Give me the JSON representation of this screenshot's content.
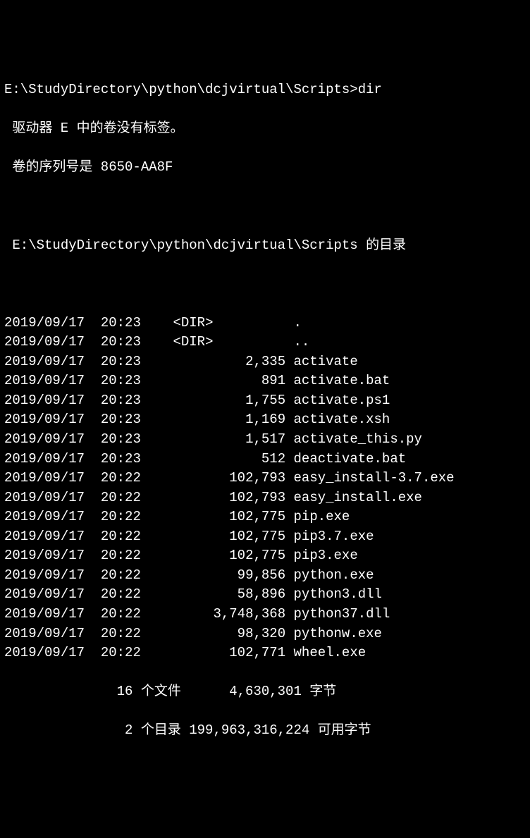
{
  "prompt": {
    "path": "E:\\StudyDirectory\\python\\dcjvirtual\\Scripts>",
    "command": "dir"
  },
  "header": {
    "volume_line": " 驱动器 E 中的卷没有标签。",
    "serial_line": " 卷的序列号是 8650-AA8F",
    "dir_path_line": " E:\\StudyDirectory\\python\\dcjvirtual\\Scripts 的目录"
  },
  "rows": [
    {
      "date": "2019/09/17",
      "time": "20:23",
      "size": "<DIR>         ",
      "name": "."
    },
    {
      "date": "2019/09/17",
      "time": "20:23",
      "size": "<DIR>         ",
      "name": ".."
    },
    {
      "date": "2019/09/17",
      "time": "20:23",
      "size": "         2,335",
      "name": "activate"
    },
    {
      "date": "2019/09/17",
      "time": "20:23",
      "size": "           891",
      "name": "activate.bat"
    },
    {
      "date": "2019/09/17",
      "time": "20:23",
      "size": "         1,755",
      "name": "activate.ps1"
    },
    {
      "date": "2019/09/17",
      "time": "20:23",
      "size": "         1,169",
      "name": "activate.xsh"
    },
    {
      "date": "2019/09/17",
      "time": "20:23",
      "size": "         1,517",
      "name": "activate_this.py"
    },
    {
      "date": "2019/09/17",
      "time": "20:23",
      "size": "           512",
      "name": "deactivate.bat"
    },
    {
      "date": "2019/09/17",
      "time": "20:22",
      "size": "       102,793",
      "name": "easy_install-3.7.exe"
    },
    {
      "date": "2019/09/17",
      "time": "20:22",
      "size": "       102,793",
      "name": "easy_install.exe"
    },
    {
      "date": "2019/09/17",
      "time": "20:22",
      "size": "       102,775",
      "name": "pip.exe"
    },
    {
      "date": "2019/09/17",
      "time": "20:22",
      "size": "       102,775",
      "name": "pip3.7.exe"
    },
    {
      "date": "2019/09/17",
      "time": "20:22",
      "size": "       102,775",
      "name": "pip3.exe"
    },
    {
      "date": "2019/09/17",
      "time": "20:22",
      "size": "        99,856",
      "name": "python.exe"
    },
    {
      "date": "2019/09/17",
      "time": "20:22",
      "size": "        58,896",
      "name": "python3.dll"
    },
    {
      "date": "2019/09/17",
      "time": "20:22",
      "size": "     3,748,368",
      "name": "python37.dll"
    },
    {
      "date": "2019/09/17",
      "time": "20:22",
      "size": "        98,320",
      "name": "pythonw.exe"
    },
    {
      "date": "2019/09/17",
      "time": "20:22",
      "size": "       102,771",
      "name": "wheel.exe"
    }
  ],
  "summary": {
    "files_line": "              16 个文件      4,630,301 字节",
    "dirs_line": "               2 个目录 199,963,316,224 可用字节"
  }
}
